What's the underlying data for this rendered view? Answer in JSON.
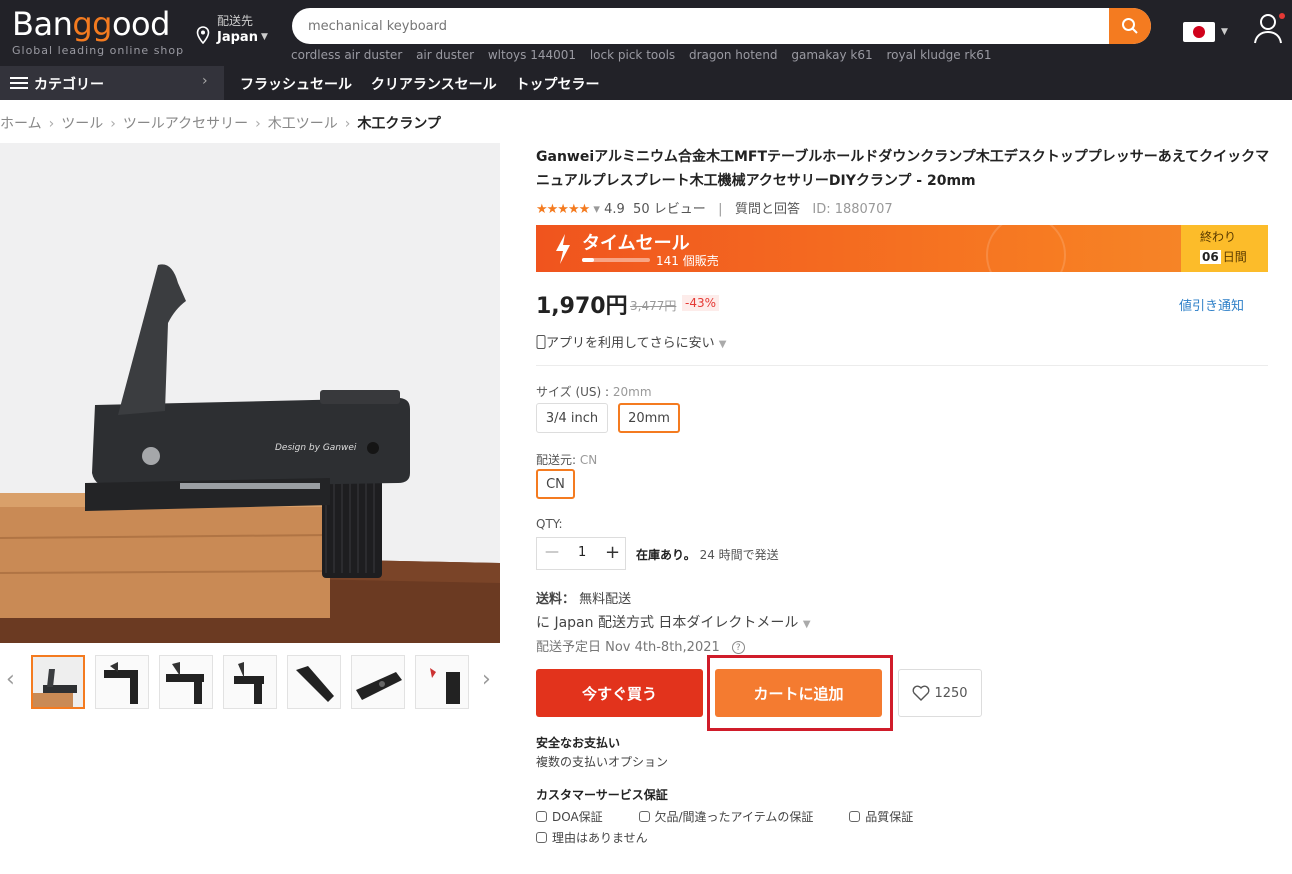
{
  "header": {
    "logo_main_a": "Ban",
    "logo_main_g": "gg",
    "logo_main_b": "ood",
    "logo_tagline": "Global leading online shop",
    "ship_to_label": "配送先",
    "ship_to_country": "Japan",
    "search_placeholder": "mechanical keyboard",
    "hot_searches": [
      "cordless air duster",
      "air duster",
      "wltoys 144001",
      "lock pick tools",
      "dragon hotend",
      "gamakay k61",
      "royal kludge rk61"
    ],
    "accent_color": "#f47b20"
  },
  "nav": {
    "category_label": "カテゴリー",
    "links": [
      "フラッシュセール",
      "クリアランスセール",
      "トップセラー"
    ]
  },
  "breadcrumb": [
    "ホーム",
    "ツール",
    "ツールアクセサリー",
    "木工ツール",
    "木工クランプ"
  ],
  "product": {
    "title": "Ganweiアルミニウム合金木工MFTテーブルホールドダウンクランプ木工デスクトッププレッサーあえてクイックマニュアルプレスプレート木工機械アクセサリーDIYクランプ - 20mm",
    "rating": "4.9",
    "reviews": "50 レビュー",
    "qa": "質問と回答",
    "id": "ID: 1880707",
    "flash_label": "タイムセール",
    "flash_sold": "141 個販売",
    "flash_progress": 0.18,
    "ends_label": "終わり",
    "ends_days": "06",
    "ends_unit": "日間",
    "price": "1,970円",
    "old_price": "3,477円",
    "discount": "-43%",
    "price_alert": "値引き通知",
    "app_promo": "アプリを利用してさらに安い",
    "size_label": "サイズ (US) : ",
    "size_value": "20mm",
    "sizes": [
      "3/4 inch",
      "20mm"
    ],
    "ship_from_label": "配送元: ",
    "ship_from_value": "CN",
    "ship_from_options": [
      "CN"
    ],
    "qty_label": "QTY:",
    "qty_value": "1",
    "stock_bold": "在庫あり。",
    "stock_note": "24 時間で発送",
    "shipping_label": "送料：",
    "shipping_value": "無料配送",
    "shipping_method": "に Japan 配送方式 日本ダイレクトメール",
    "delivery": "配送予定日 Nov 4th-8th,2021",
    "buy_now": "今すぐ買う",
    "add_to_cart": "カートに追加",
    "wishlist_count": "1250",
    "safe_pay_title": "安全なお支払い",
    "safe_pay_text": "複数の支払いオプション",
    "service_title": "カスタマーサービス保証",
    "guarantees": [
      "DOA保証",
      "欠品/間違ったアイテムの保証",
      "品質保証"
    ],
    "no_reason": "理由はありません"
  }
}
